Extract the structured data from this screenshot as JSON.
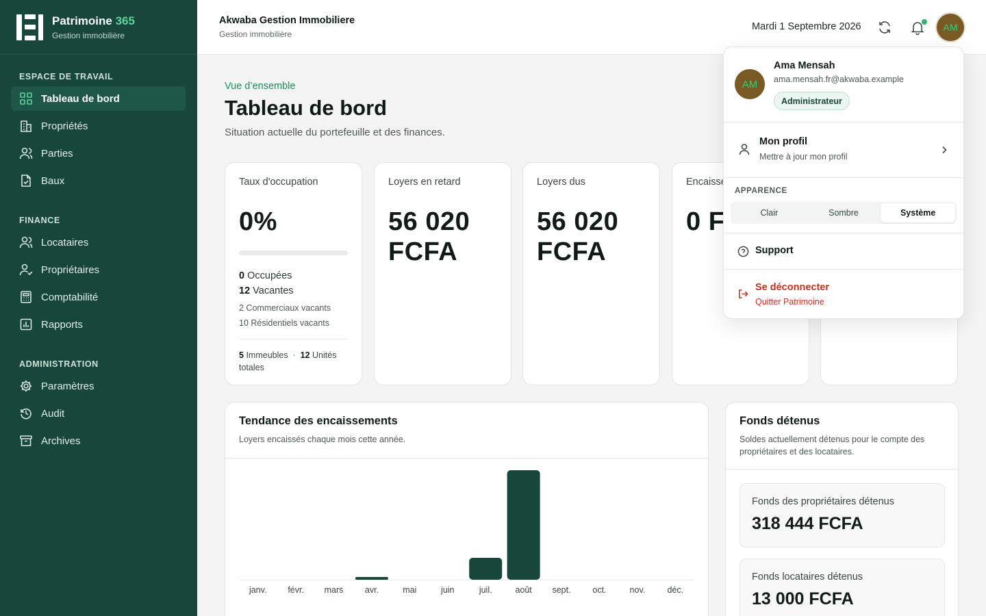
{
  "brand": {
    "name": "Patrimoine",
    "name_accent": "365",
    "subtitle": "Gestion immobilière"
  },
  "sidebar": {
    "sections": [
      {
        "label": "ESPACE DE TRAVAIL",
        "items": [
          {
            "label": "Tableau de bord",
            "icon": "grid-icon",
            "active": true
          },
          {
            "label": "Propriétés",
            "icon": "building-icon"
          },
          {
            "label": "Parties",
            "icon": "users-icon"
          },
          {
            "label": "Baux",
            "icon": "document-icon"
          }
        ]
      },
      {
        "label": "FINANCE",
        "items": [
          {
            "label": "Locataires",
            "icon": "users-icon"
          },
          {
            "label": "Propriétaires",
            "icon": "user-check-icon"
          },
          {
            "label": "Comptabilité",
            "icon": "calculator-icon"
          },
          {
            "label": "Rapports",
            "icon": "bar-chart-icon"
          }
        ]
      },
      {
        "label": "ADMINISTRATION",
        "items": [
          {
            "label": "Paramètres",
            "icon": "gear-icon"
          },
          {
            "label": "Audit",
            "icon": "history-icon"
          },
          {
            "label": "Archives",
            "icon": "archive-icon"
          }
        ]
      }
    ]
  },
  "header": {
    "org_name": "Akwaba Gestion Immobiliere",
    "org_sub": "Gestion immobilière",
    "date": "Mardi 1 Septembre 2026",
    "avatar_initials": "AM"
  },
  "page": {
    "eyebrow": "Vue d’ensemble",
    "title": "Tableau de bord",
    "subtitle": "Situation actuelle du portefeuille et des finances."
  },
  "kpis": {
    "occupancy": {
      "label": "Taux d'occupation",
      "value": "0%",
      "progress_fraction": 0,
      "occupied_count": "0",
      "occupied_label": "Occupées",
      "vacant_count": "12",
      "vacant_label": "Vacantes",
      "commercial_vacant": "2 Commerciaux vacants",
      "residential_vacant": "10 Résidentiels vacants",
      "buildings_count": "5",
      "buildings_label": "Immeubles",
      "units_count": "12",
      "units_label": "Unités totales"
    },
    "late_rent": {
      "label": "Loyers en retard",
      "value": "56 020 FCFA"
    },
    "due_rent": {
      "label": "Loyers dus",
      "value": "56 020 FCFA"
    },
    "collected": {
      "label": "Encaisse",
      "value": "0 F"
    }
  },
  "trend": {
    "title": "Tendance des encaissements",
    "subtitle": "Loyers encaissés chaque mois cette année."
  },
  "chart_data": {
    "type": "bar",
    "title": "Tendance des encaissements",
    "categories": [
      "janv.",
      "févr.",
      "mars",
      "avr.",
      "mai",
      "juin",
      "juil.",
      "août",
      "sept.",
      "oct.",
      "nov.",
      "déc."
    ],
    "values": [
      0,
      0,
      0,
      2,
      0,
      0,
      20,
      100,
      0,
      0,
      0,
      0
    ],
    "ylim": [
      0,
      100
    ],
    "grid": false,
    "color": "#17463a"
  },
  "funds": {
    "title": "Fonds détenus",
    "subtitle": "Soldes actuellement détenus pour le compte des propriétaires et des locataires.",
    "owners_label": "Fonds des propriétaires détenus",
    "owners_value": "318 444 FCFA",
    "tenants_label": "Fonds locataires détenus",
    "tenants_value": "13 000 FCFA"
  },
  "user_menu": {
    "name": "Ama Mensah",
    "email": "ama.mensah.fr@akwaba.example",
    "role": "Administrateur",
    "initials": "AM",
    "profile_title": "Mon profil",
    "profile_sub": "Mettre à jour mon profil",
    "appearance_label": "APPARENCE",
    "appearance_options": [
      "Clair",
      "Sombre",
      "Système"
    ],
    "appearance_selected": "Système",
    "support_label": "Support",
    "logout_title": "Se déconnecter",
    "logout_sub": "Quitter Patrimoine"
  },
  "colors": {
    "sidebar": "#17463a",
    "accent": "#5fd39a",
    "danger": "#c4321e"
  }
}
